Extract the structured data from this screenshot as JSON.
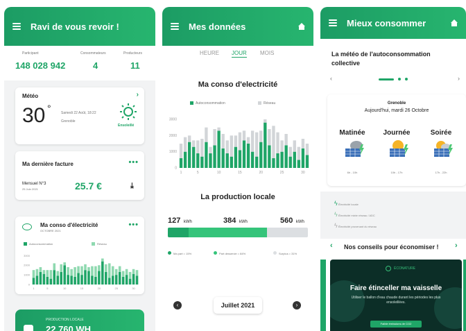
{
  "screen1": {
    "header_title": "Ravi de vous revoir !",
    "stats": [
      {
        "label": "Participant",
        "value": "148 028 942"
      },
      {
        "label": "Consommateurs",
        "value": "4"
      },
      {
        "label": "Producteurs",
        "value": "11"
      }
    ],
    "weather": {
      "title": "Météo",
      "temp": "30",
      "degree": "°",
      "date": "Samedi 22 Août, 18:22",
      "city": "Grenoble",
      "condition": "Ensoleillé"
    },
    "invoice": {
      "title": "Ma dernière facture",
      "monthly": "Mensuel N°3",
      "date": "25 Juin 2021",
      "amount": "25.7 €"
    },
    "conso": {
      "title": "Ma conso d'électricité",
      "subtitle": "OCTOBRE 2021",
      "legend_auto": "Autoconsommation",
      "legend_reseau": "Réseau"
    },
    "production": {
      "label": "PRODUCTION LOCALE",
      "value": "22 760 WH"
    }
  },
  "screen2": {
    "header_title": "Mes données",
    "tabs": [
      "HEURE",
      "JOUR",
      "MOIS"
    ],
    "active_tab": "JOUR",
    "chart_title": "Ma conso d'electricité",
    "legend_auto": "Autoconsommation",
    "legend_reseau": "Réseau",
    "production_title": "La production locale",
    "kwh": [
      {
        "value": "127",
        "unit": "kWh"
      },
      {
        "value": "384",
        "unit": "kWh"
      },
      {
        "value": "560",
        "unit": "kWh"
      }
    ],
    "prod_legend": [
      "Ma part = 15%",
      "Part desservie = 84%",
      "Surplus = 31%"
    ],
    "month": "Juillet 2021"
  },
  "screen3": {
    "header_title": "Mieux consommer",
    "meteo_title": "La météo de l'autoconsommation collective",
    "city": "Grenoble",
    "date": "Aujourd'hui, mardi 26 Octobre",
    "periods": [
      {
        "name": "Matinée",
        "range": "6h - 10h"
      },
      {
        "name": "Journée",
        "range": "10h - 17h"
      },
      {
        "name": "Soirée",
        "range": "17h - 22h"
      }
    ],
    "legend": [
      "Électricité locale",
      "Électricité mixte réseau / ADC",
      "Électricité provenant du réseau"
    ],
    "tips_title": "Nos conseils pour économiser !",
    "promo_brand": "ÉCONATURE",
    "promo_title": "Faire étinceller ma vaisselle",
    "promo_text": "Utiliser le ballon d'eau chaude durant les périodes les plus ensoleillées.",
    "promo_button": "Faible émissions de CO2"
  },
  "chart_data": [
    {
      "type": "bar",
      "title": "Ma conso d'electricité",
      "xlabel": "",
      "ylabel": "",
      "x": [
        1,
        2,
        3,
        4,
        5,
        6,
        7,
        8,
        9,
        10,
        11,
        12,
        13,
        14,
        15,
        16,
        17,
        18,
        19,
        20,
        21,
        22,
        23,
        24,
        25,
        26,
        27,
        28,
        29,
        30,
        31
      ],
      "tick_labels": [
        "1",
        "5",
        "10",
        "15",
        "20",
        "25",
        "30"
      ],
      "y_tick_labels": [
        "3000",
        "2000",
        "1000",
        "0"
      ],
      "ylim": [
        0,
        3600
      ],
      "stacked": true,
      "series": [
        {
          "name": "Autoconsommation",
          "color": "#1fa567",
          "values": [
            600,
            1000,
            1600,
            1300,
            900,
            700,
            1600,
            900,
            1400,
            2300,
            1200,
            900,
            700,
            1300,
            1100,
            1700,
            1500,
            1000,
            700,
            1600,
            2800,
            1400,
            600,
            900,
            1000,
            1400,
            700,
            1000,
            500,
            1200,
            800
          ]
        },
        {
          "name": "Réseau",
          "color": "#d2d5d8",
          "values": [
            900,
            900,
            400,
            400,
            800,
            1100,
            900,
            400,
            1000,
            200,
            900,
            800,
            1300,
            700,
            1100,
            600,
            400,
            1300,
            1500,
            700,
            200,
            1000,
            2000,
            1300,
            700,
            700,
            600,
            700,
            800,
            600,
            700
          ]
        }
      ]
    },
    {
      "type": "bar",
      "title": "Ma conso d'électricité",
      "x": [
        1,
        2,
        3,
        4,
        5,
        6,
        7,
        8,
        9,
        10,
        11,
        12,
        13,
        14,
        15,
        16,
        17,
        18,
        19,
        20,
        21,
        22,
        23,
        24,
        25,
        26,
        27,
        28,
        29,
        30,
        31
      ],
      "tick_labels": [
        "1",
        "5",
        "10",
        "15",
        "20",
        "25",
        "30"
      ],
      "y_tick_labels": [
        "3000",
        "2000",
        "1000",
        "0"
      ],
      "ylim": [
        0,
        3600
      ],
      "stacked": true,
      "series": [
        {
          "name": "Autoconsommation",
          "color": "#1fa567",
          "values": [
            700,
            900,
            1300,
            1100,
            800,
            600,
            1500,
            900,
            1300,
            2000,
            1000,
            900,
            800,
            1200,
            1000,
            1500,
            1400,
            900,
            800,
            1400,
            2400,
            1300,
            700,
            900,
            1000,
            1300,
            800,
            1000,
            600,
            1100,
            900
          ]
        },
        {
          "name": "Réseau",
          "color": "#8fd9b0",
          "values": [
            800,
            700,
            500,
            400,
            700,
            900,
            700,
            500,
            800,
            300,
            800,
            700,
            1000,
            700,
            900,
            600,
            400,
            1000,
            1100,
            600,
            300,
            800,
            1500,
            1000,
            600,
            600,
            600,
            600,
            700,
            500,
            600
          ]
        }
      ]
    }
  ]
}
